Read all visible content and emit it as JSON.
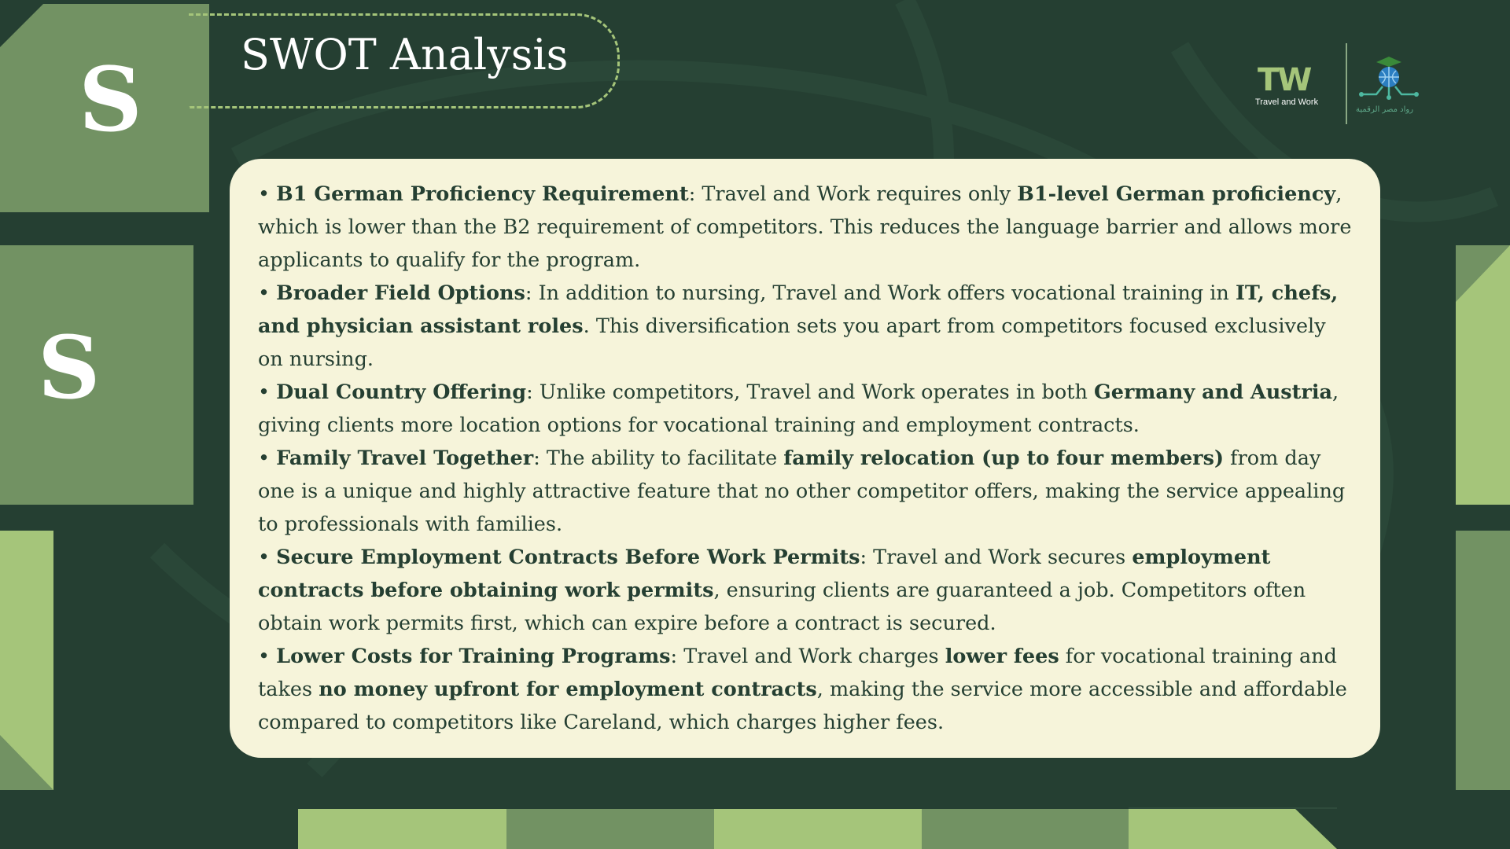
{
  "slide": {
    "title": "SWOT Analysis",
    "letter_top": "S",
    "letter_mid": "S"
  },
  "logos": {
    "tw_glyph": "TW",
    "tw_caption": "Travel and Work",
    "partner_caption": "رواد مصر الرقمية"
  },
  "colors": {
    "background": "#253f32",
    "block_dark": "#729263",
    "block_light": "#a5c57a",
    "card": "#f6f4da",
    "text": "#253f32"
  },
  "strengths": [
    {
      "label": "B1 German Proficiency Requirement",
      "t1": ": Travel and Work requires only ",
      "b1": "B1-level German proficiency",
      "t2": ", which is lower than the B2 requirement of competitors. This reduces the language barrier and allows more applicants to qualify for the program."
    },
    {
      "label": "Broader Field Options",
      "t1": ": In addition to nursing, Travel and Work offers vocational training in ",
      "b1": "IT, chefs, and physician assistant roles",
      "t2": ". This diversification sets you apart from competitors focused exclusively on nursing."
    },
    {
      "label": "Dual Country Offering",
      "t1": ": Unlike competitors, Travel and Work operates in both ",
      "b1": "Germany and Austria",
      "t2": ", giving clients more location options for vocational training and employment contracts."
    },
    {
      "label": "Family Travel Together",
      "t1": ": The ability to facilitate ",
      "b1": "family relocation (up to four members)",
      "t2": " from day one is a unique and highly attractive feature that no other competitor offers, making the service appealing to professionals with families."
    },
    {
      "label": "Secure Employment Contracts Before Work Permits",
      "t1": ": Travel and Work secures ",
      "b1": "employment contracts before obtaining work permits",
      "t2": ", ensuring clients are guaranteed a job. Competitors often obtain work permits first, which can expire before a contract is secured."
    },
    {
      "label": "Lower Costs for Training Programs",
      "t1": ": Travel and Work charges ",
      "b1": "lower fees",
      "t2": " for vocational training and takes ",
      "b2": "no money upfront for employment contracts",
      "t3": ", making the service more accessible and affordable compared to competitors like Careland, which charges higher fees."
    }
  ]
}
